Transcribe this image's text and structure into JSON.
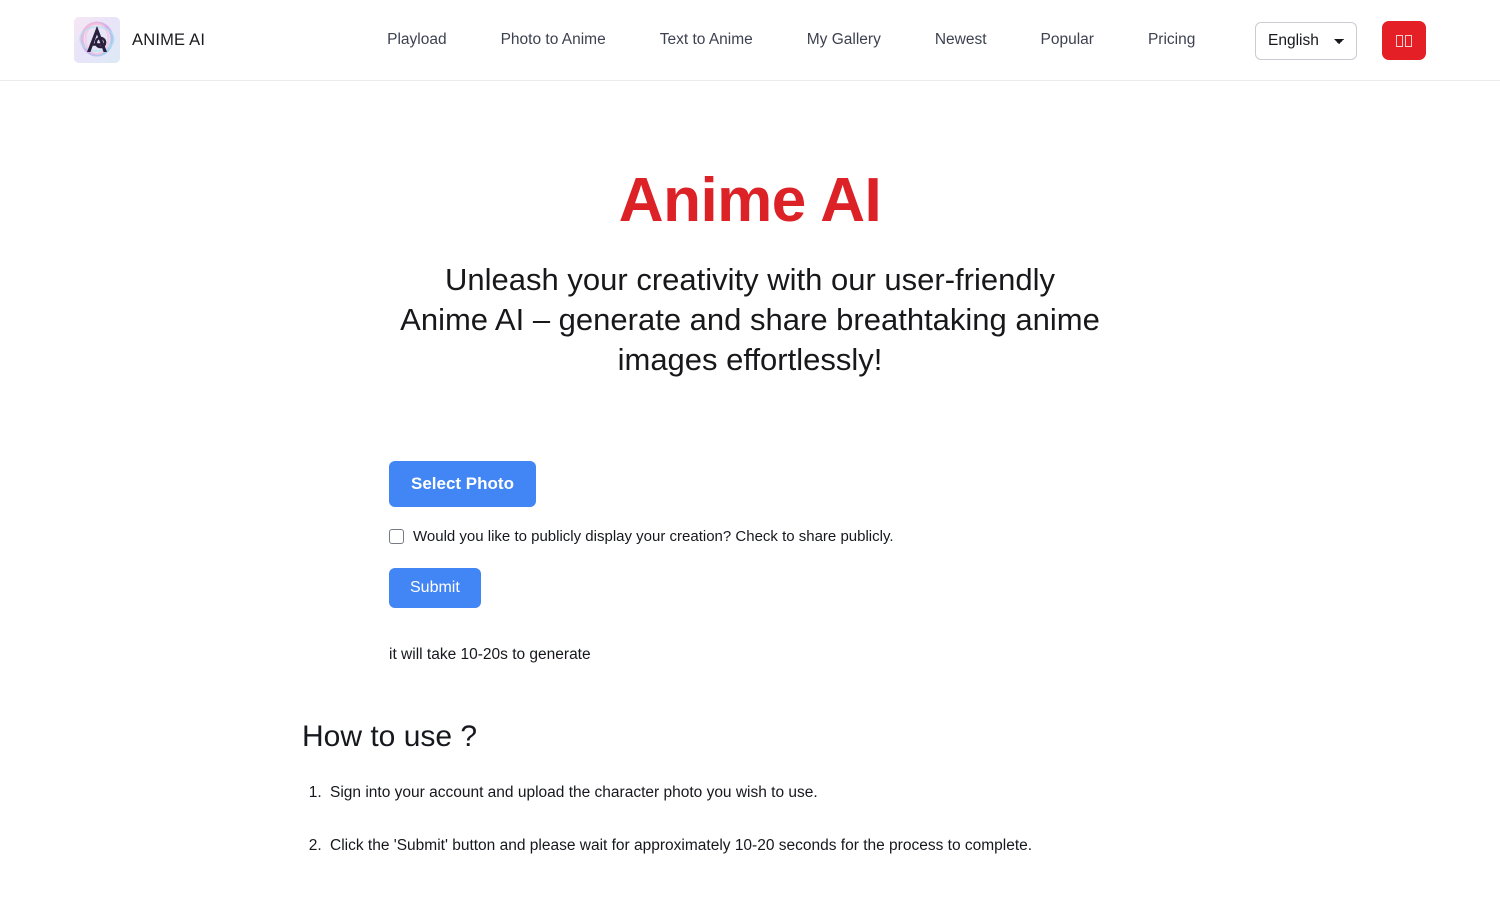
{
  "header": {
    "logo_icon": "anime-ai-logo-icon",
    "brand_name": "ANIME AI",
    "nav": [
      {
        "label": "Playload"
      },
      {
        "label": "Photo to Anime"
      },
      {
        "label": "Text to Anime"
      },
      {
        "label": "My Gallery"
      },
      {
        "label": "Newest"
      },
      {
        "label": "Popular"
      },
      {
        "label": "Pricing"
      }
    ],
    "language": {
      "selected": "English",
      "options": [
        "English"
      ],
      "chevron_icon": "chevron-down-icon"
    },
    "login_button": {
      "label": "□□",
      "color": "#e41f25"
    }
  },
  "hero": {
    "title": "Anime AI",
    "title_color": "#dc2127",
    "subtitle": "Unleash your creativity with our user-friendly Anime AI – generate and share breathtaking anime images effortlessly!"
  },
  "form": {
    "select_photo_label": "Select Photo",
    "accent_color": "#4285f4",
    "checkbox": {
      "label": "Would you like to publicly display your creation? Check to share publicly.",
      "checked": false
    },
    "submit_label": "Submit",
    "note": "it will take 10-20s to generate"
  },
  "howto": {
    "title": "How to use ?",
    "steps": [
      "Sign into your account and upload the character photo you wish to use.",
      "Click the 'Submit' button and please wait for approximately 10-20 seconds for the process to complete."
    ]
  }
}
